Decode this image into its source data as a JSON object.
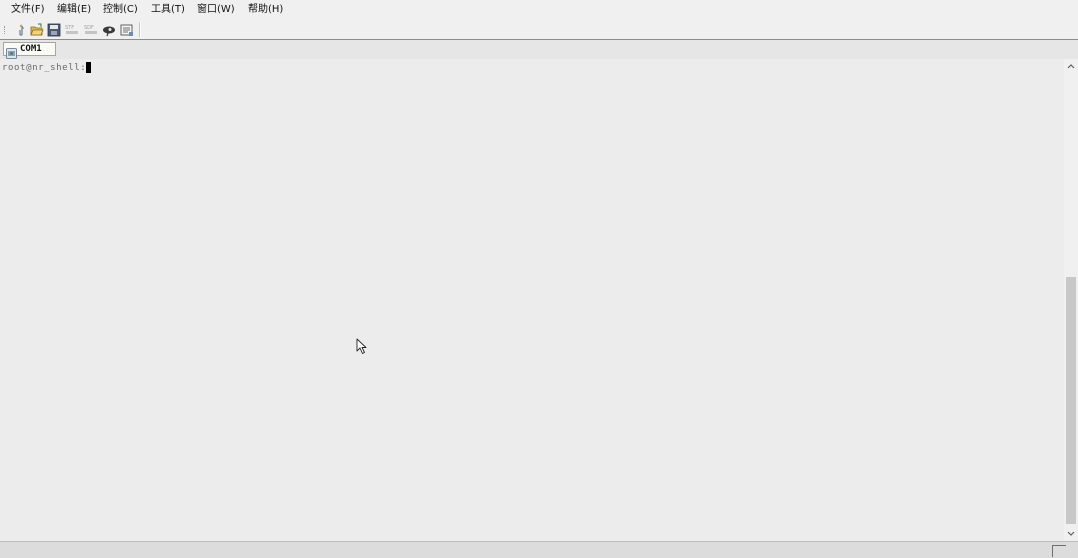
{
  "menubar": {
    "items": [
      {
        "label": "文件(F)"
      },
      {
        "label": "编辑(E)"
      },
      {
        "label": "控制(C)"
      },
      {
        "label": "工具(T)"
      },
      {
        "label": "窗口(W)"
      },
      {
        "label": "帮助(H)"
      }
    ]
  },
  "toolbar": {
    "buttons": [
      {
        "icon": "new-connection-icon"
      },
      {
        "icon": "open-folder-icon"
      },
      {
        "icon": "save-icon"
      },
      {
        "icon": "send-file-icon"
      },
      {
        "icon": "receive-file-icon"
      },
      {
        "icon": "hide-icon"
      },
      {
        "icon": "properties-icon"
      }
    ]
  },
  "tabs": [
    {
      "label": "COM1",
      "icon": "serial-port-icon",
      "active": true
    }
  ],
  "terminal": {
    "prompt": "root@nr_shell:",
    "background": "#ececec",
    "text_color": "#6a6a6a"
  },
  "colors": {
    "window_bg": "#ececec",
    "tab_border_accent": "#c9a35a",
    "scroll_thumb": "#c8c8c8"
  }
}
